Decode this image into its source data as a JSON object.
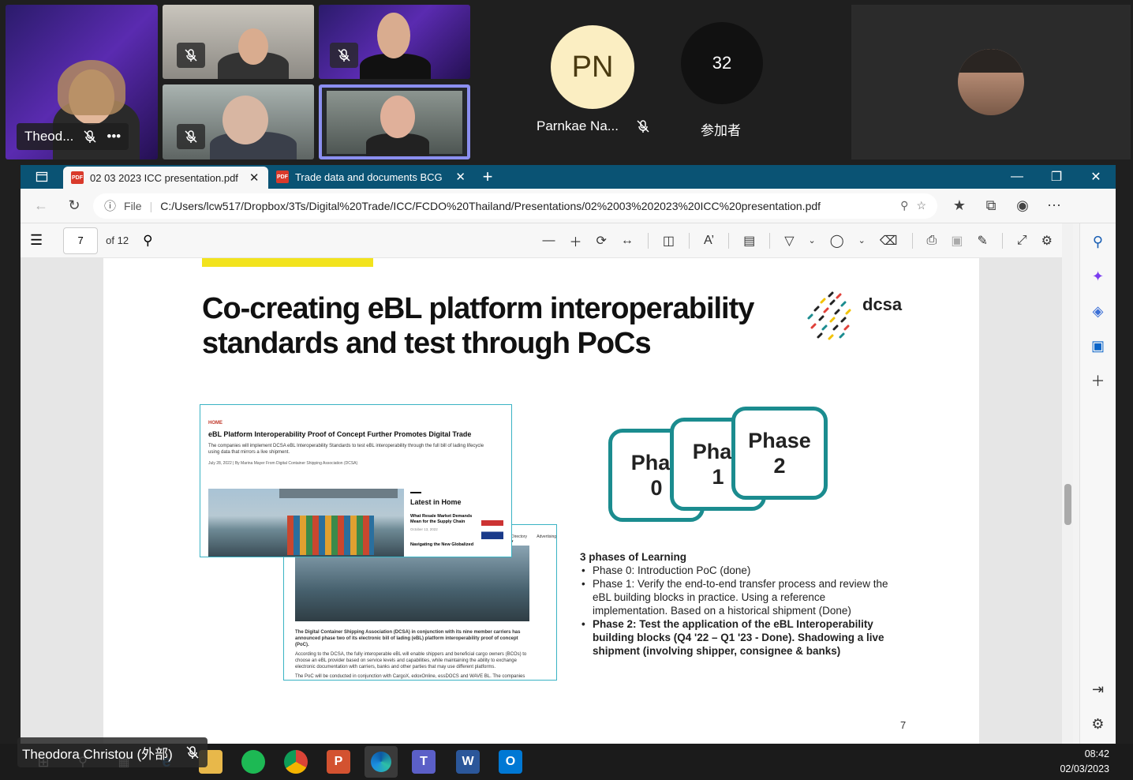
{
  "meeting": {
    "participants": [
      {
        "name": "Theod...",
        "muted": true
      },
      {
        "name": "",
        "muted": true
      },
      {
        "name": "",
        "muted": true
      },
      {
        "name": "",
        "muted": true
      },
      {
        "name": "",
        "muted": false
      }
    ],
    "avatar_initials": "PN",
    "avatar_name": "Parnkae Na...",
    "participant_count": "32",
    "participant_count_label": "参加者",
    "more_label": "•••",
    "speaker_caption": "Theodora Christou (外部)"
  },
  "browser": {
    "tabs": [
      {
        "label": "02 03 2023 ICC presentation.pdf",
        "active": true,
        "icon": "PDF"
      },
      {
        "label": "Trade data and documents BCG p",
        "active": false,
        "icon": "PDF"
      }
    ],
    "tab_close": "✕",
    "new_tab": "+",
    "address": {
      "protocol": "File",
      "url": "C:/Users/lcw517/Dropbox/3Ts/Digital%20Trade/ICC/FCDO%20Thailand/Presentations/02%2003%202023%20ICC%20presentation.pdf"
    }
  },
  "pdf_toolbar": {
    "page_current": "7",
    "page_total_label": "of 12"
  },
  "slide": {
    "title": "Co-creating eBL platform interoperability standards and test through PoCs",
    "logo_text": "dcsa",
    "article": {
      "section": "HOME",
      "headline": "eBL Platform Interoperability Proof of Concept Further Promotes Digital Trade",
      "summary": "The companies will implement DCSA eBL Interoperability Standards to test eBL interoperability through the full bill of lading lifecycle using data that mirrors a live shipment.",
      "byline": "July 28, 2022 | By Marina Mayer From Digital Container Shipping Association (DCSA)",
      "sidebar_title": "Latest in Home",
      "sidebar_item_1": "What Resale Market Demands Mean for the Supply Chain",
      "sidebar_date_1": "October 13, 2022",
      "sidebar_item_2": "Navigating the New Globalized",
      "nav_1": "Directory ▾",
      "nav_2": "Advertising",
      "back_body_1": "The Digital Container Shipping Association (DCSA) in conjunction with its nine member carriers has announced phase two of its electronic bill of lading (eBL) platform interoperability proof of concept (PoC).",
      "back_body_2": "According to the DCSA, the fully interoperable eBL will enable shippers and beneficial cargo owners (BCOs) to choose an eBL provider based on service levels and capabilities, while maintaining the ability to exchange electronic documentation with carriers, banks and other parties that may use different platforms.",
      "back_body_3": "The PoC will be conducted in conjunction with CargoX, edoxOnline, essDOCS and WAVE BL. The companies will implement DCSA eBL Interoperability Standards to test eBL interoperability through the full bill of lading lifecycle using data that mirrors a live shipment."
    },
    "phase_cards": [
      {
        "line1": "Phas",
        "line2": "0"
      },
      {
        "line1": "Phas",
        "line2": "1"
      },
      {
        "line1": "Phase",
        "line2": "2"
      }
    ],
    "phases_heading": "3 phases of Learning",
    "phases": [
      {
        "text": "Phase 0: Introduction PoC (done)",
        "bold": false
      },
      {
        "text": "Phase 1: Verify the end-to-end transfer process and review the eBL building blocks in practice. Using a reference implementation. Based on a historical shipment (Done)",
        "bold": false
      },
      {
        "text": "Phase 2: Test the application of the eBL Interoperability building blocks (Q4 '22 – Q1 '23 - Done). Shadowing a live shipment (involving shipper, consignee & banks)",
        "bold": true
      }
    ],
    "page_number": "7"
  },
  "taskbar": {
    "time": "08:42",
    "date": "02/03/2023"
  }
}
